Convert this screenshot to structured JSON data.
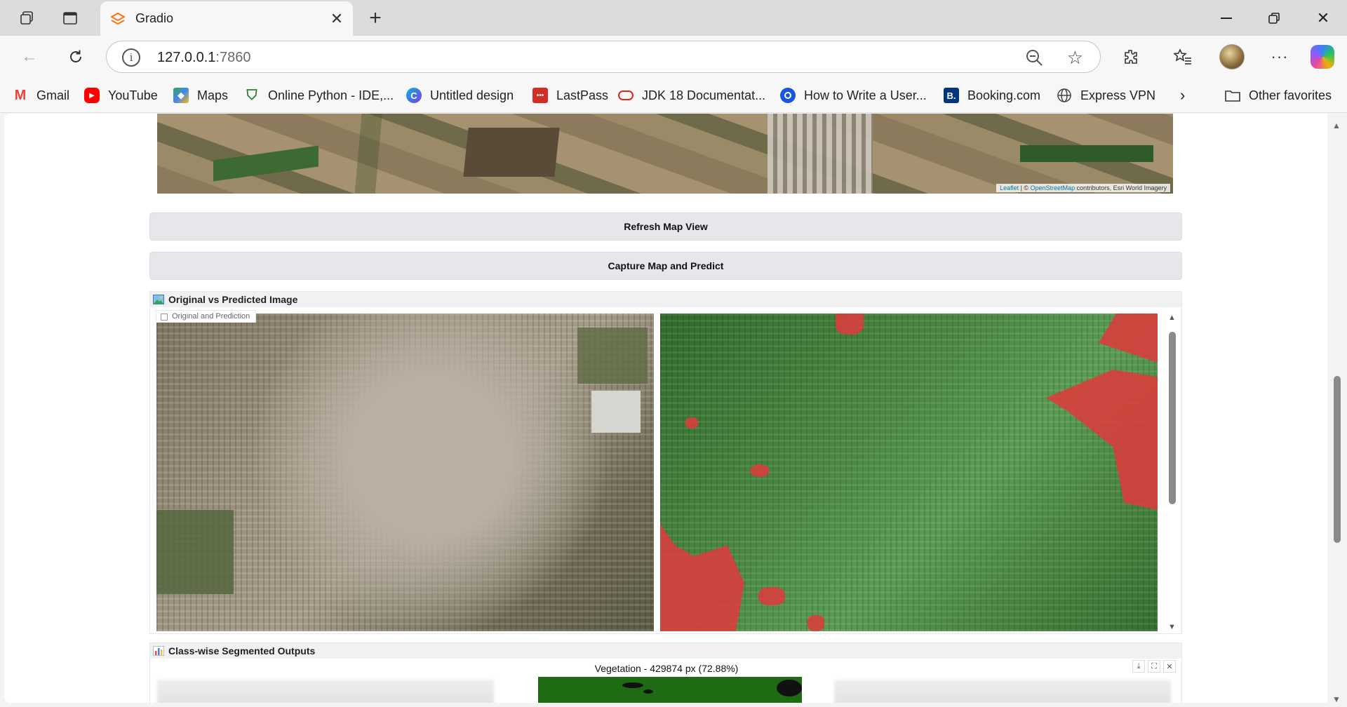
{
  "browser": {
    "tab_title": "Gradio",
    "url_host": "127.0.0.1",
    "url_port": ":7860",
    "bookmarks": [
      {
        "label": "Gmail",
        "icon": "gmail-icon",
        "color": "#ea4335"
      },
      {
        "label": "YouTube",
        "icon": "youtube-icon",
        "color": "#ff0000"
      },
      {
        "label": "Maps",
        "icon": "maps-icon",
        "color": "#34a853"
      },
      {
        "label": "Online Python - IDE,...",
        "icon": "shield-icon",
        "color": "#2e7d32"
      },
      {
        "label": "Untitled design",
        "icon": "canva-icon",
        "color": "#7c3aed"
      },
      {
        "label": "LastPass",
        "icon": "lastpass-icon",
        "color": "#d32d27"
      },
      {
        "label": "JDK 18 Documentat...",
        "icon": "oracle-icon",
        "color": "#e0261b"
      },
      {
        "label": "How to Write a User...",
        "icon": "search-circle-icon",
        "color": "#1a56db"
      },
      {
        "label": "Booking.com",
        "icon": "booking-icon",
        "color": "#003580"
      },
      {
        "label": "Express VPN",
        "icon": "globe-icon",
        "color": "#444444"
      }
    ],
    "other_favorites": "Other favorites"
  },
  "map": {
    "attribution_leaflet": "Leaflet",
    "attribution_sep": " | © ",
    "attribution_osm": "OpenStreetMap",
    "attribution_rest": " contributors, Esri World Imagery"
  },
  "buttons": {
    "refresh": "Refresh Map View",
    "capture": "Capture Map and Predict"
  },
  "comparison": {
    "header": "Original vs Predicted Image",
    "inner_label": "Original and Prediction"
  },
  "classwise": {
    "header": "Class-wise Segmented Outputs",
    "plot_title": "Vegetation - 429874 px (72.88%)"
  },
  "colors": {
    "prediction_class_red": "#dc3c3c",
    "prediction_class_green": "#4c8a45",
    "vegetation_bar": "#1f6b14"
  }
}
